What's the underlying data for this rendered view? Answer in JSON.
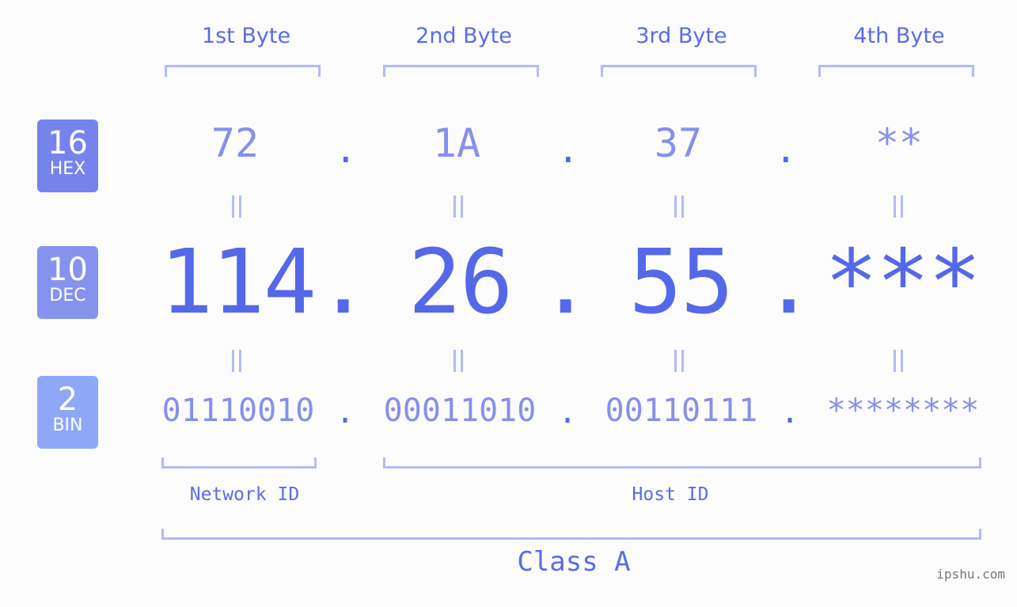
{
  "byte_headers": [
    "1st Byte",
    "2nd Byte",
    "3rd Byte",
    "4th Byte"
  ],
  "badges": [
    {
      "base": "16",
      "name": "HEX",
      "color": "#7683ec"
    },
    {
      "base": "10",
      "name": "DEC",
      "color": "#8593ef"
    },
    {
      "base": "2",
      "name": "BIN",
      "color": "#8fa7f7"
    }
  ],
  "hex": [
    "72",
    "1A",
    "37",
    "**"
  ],
  "dec": [
    "114",
    "26",
    "55",
    "***"
  ],
  "bin": [
    "01110010",
    "00011010",
    "00110111",
    "********"
  ],
  "separator": ".",
  "labels": {
    "network": "Network ID",
    "host": "Host ID",
    "class": "Class A"
  },
  "watermark": "ipshu.com",
  "colors": {
    "accent": "#5468e8",
    "light_value": "#8590eb",
    "bracket": "#b3bbf5",
    "background": "#fbfcfb"
  }
}
